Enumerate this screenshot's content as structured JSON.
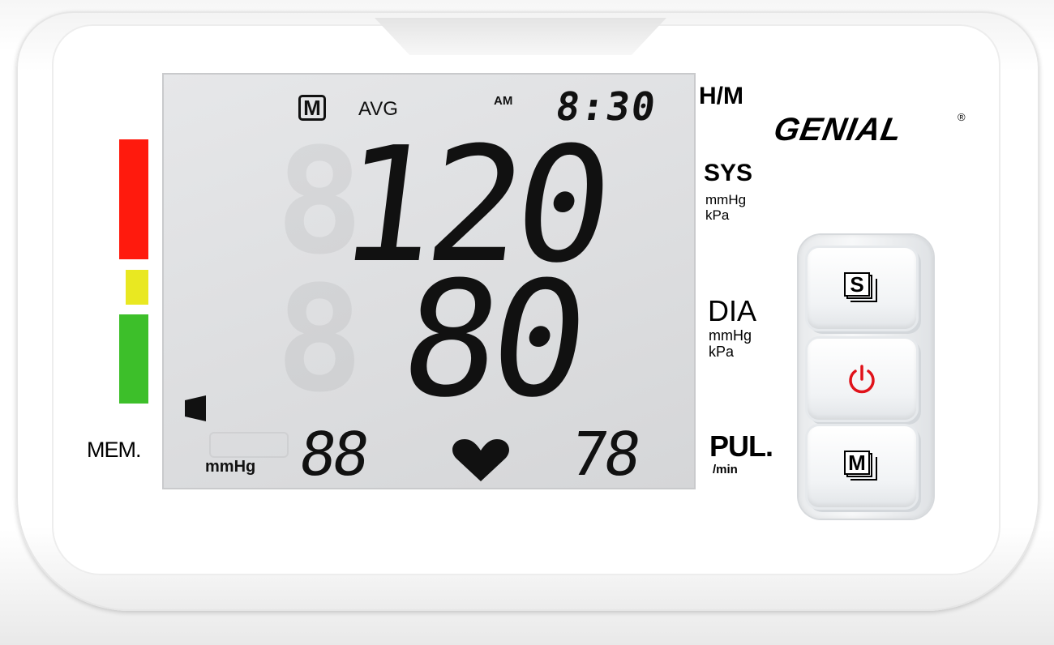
{
  "brand": {
    "name": "GENIAL",
    "registered": "®"
  },
  "display": {
    "memory_indicator": "M",
    "avg_label": "AVG",
    "time": {
      "meridiem": "AM",
      "value": "8:30"
    },
    "systolic": "120",
    "diastolic": "80",
    "unit": "mmHg",
    "memory_number": "88",
    "pulse": "78"
  },
  "labels": {
    "time_format": "H/M",
    "sys": "SYS",
    "sys_unit_1": "mmHg",
    "sys_unit_2": "kPa",
    "dia": "DIA",
    "dia_unit_1": "mmHg",
    "dia_unit_2": "kPa",
    "pul": "PUL.",
    "pul_unit": "/min",
    "mem": "MEM."
  },
  "risk_scale": {
    "colors": [
      "#ff1a0d",
      "#e9e821",
      "#3dbf2a"
    ]
  },
  "buttons": {
    "s": {
      "icon": "set-icon",
      "glyph": "S"
    },
    "power": {
      "icon": "power-icon",
      "color": "#e0121a"
    },
    "m": {
      "icon": "memory-icon",
      "glyph": "M"
    }
  }
}
